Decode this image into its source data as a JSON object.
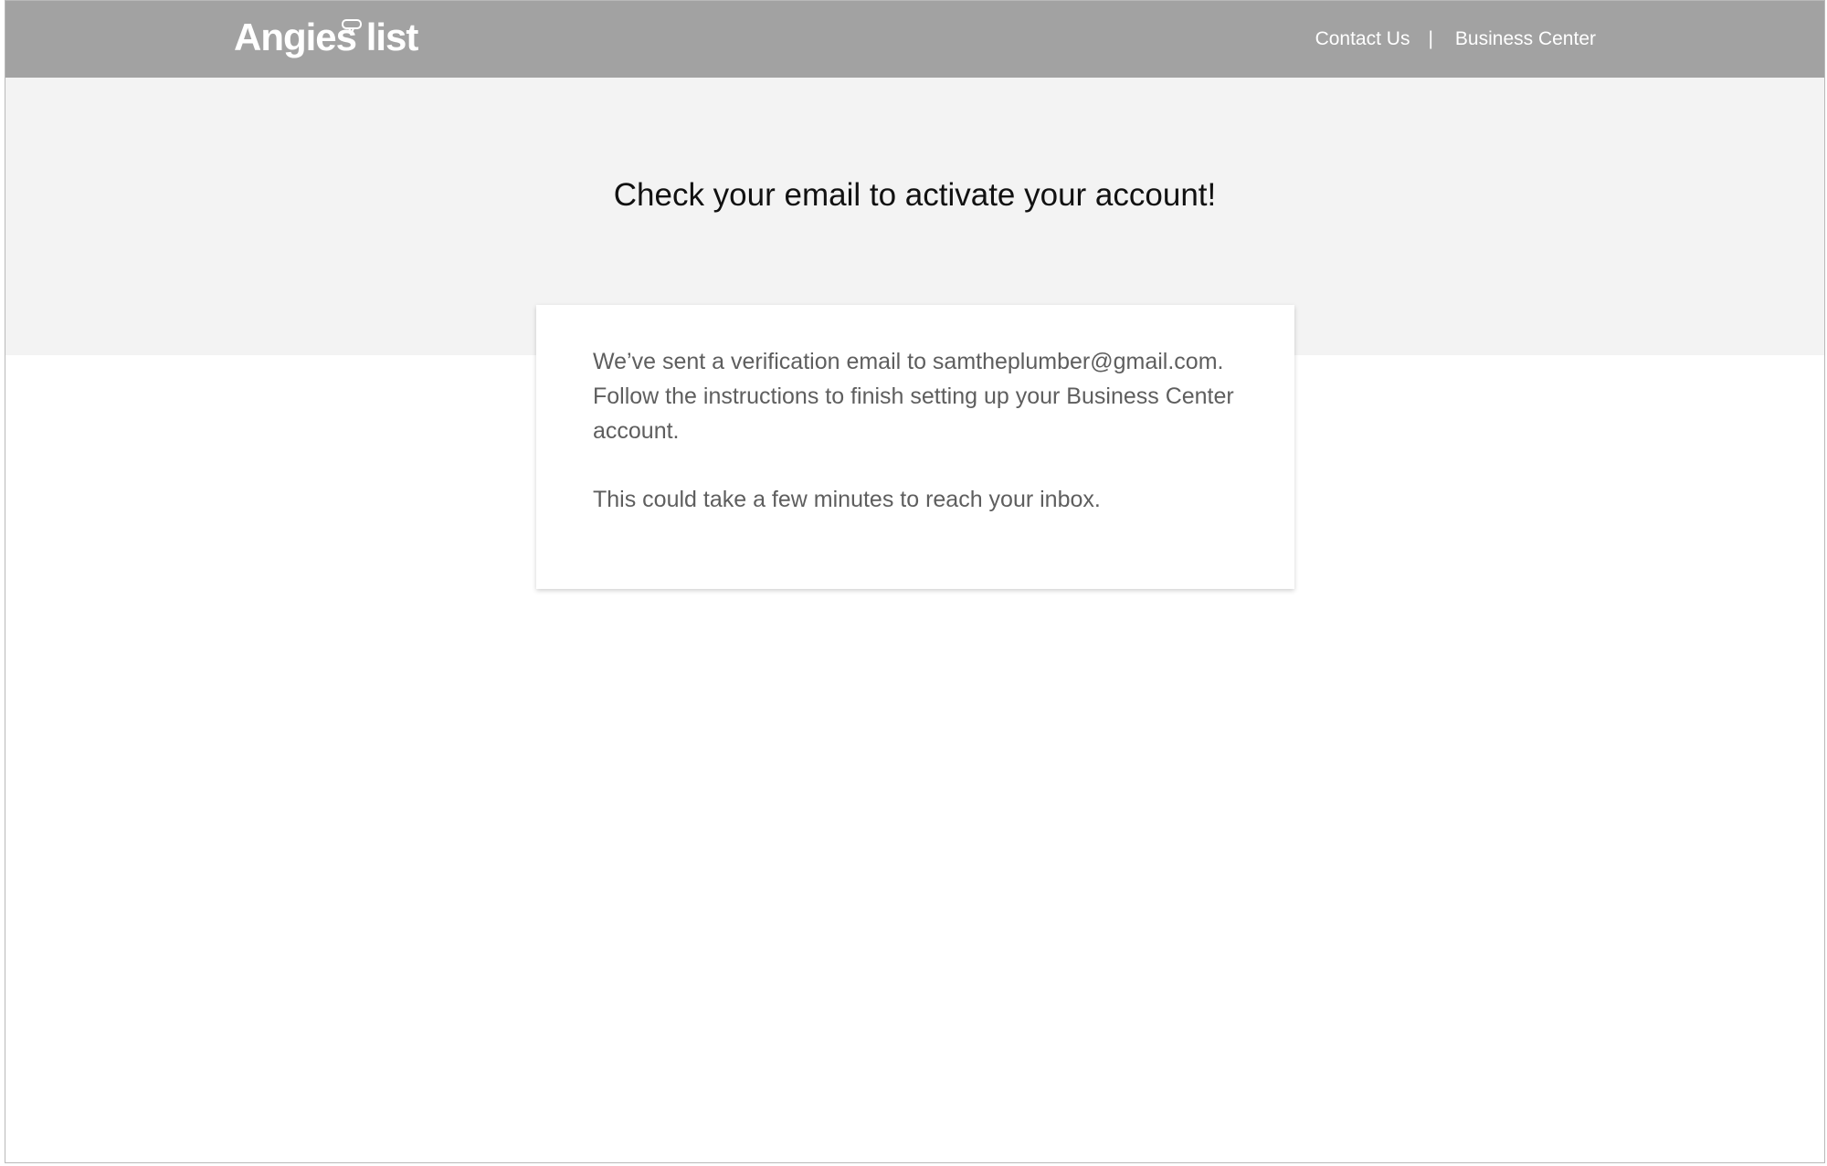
{
  "header": {
    "logo_text": "Angies list",
    "nav": {
      "contact_label": "Contact Us",
      "separator": "|",
      "business_center_label": "Business Center"
    }
  },
  "hero": {
    "title": "Check your email to activate your account!"
  },
  "card": {
    "message": "We’ve sent a verification email to samtheplumber@gmail.com. Follow the instructions to finish setting up your Business Center account.",
    "note": "This could take a few minutes to reach your inbox."
  },
  "colors": {
    "header_bg": "#a2a2a2",
    "hero_bg": "#f3f3f3",
    "card_text": "#5e5e5e"
  }
}
